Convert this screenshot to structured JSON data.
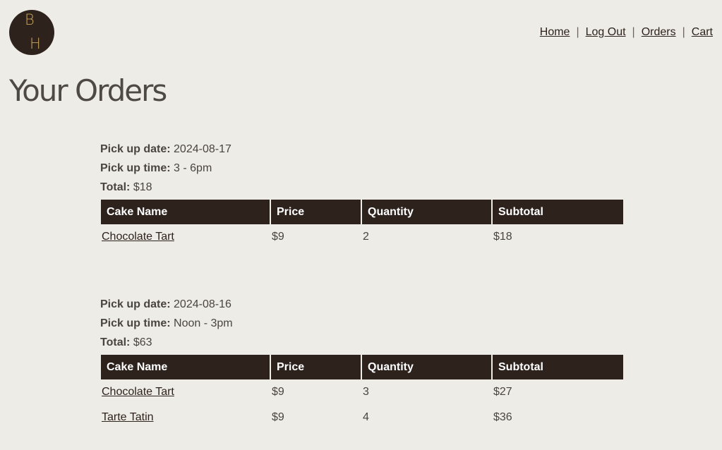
{
  "logo": {
    "top_letter": "B",
    "bottom_letter": "H"
  },
  "nav": {
    "items": [
      "Home",
      "Log Out",
      "Orders",
      "Cart"
    ],
    "separator": "|"
  },
  "page_title": "Your Orders",
  "labels": {
    "pickup_date": "Pick up date:",
    "pickup_time": "Pick up time:",
    "total": "Total:"
  },
  "table_headers": [
    "Cake Name",
    "Price",
    "Quantity",
    "Subtotal"
  ],
  "orders": [
    {
      "pickup_date": "2024-08-17",
      "pickup_time": "3 - 6pm",
      "total": "$18",
      "items": [
        {
          "name": "Chocolate Tart",
          "price": "$9",
          "quantity": "2",
          "subtotal": "$18"
        }
      ]
    },
    {
      "pickup_date": "2024-08-16",
      "pickup_time": "Noon - 3pm",
      "total": "$63",
      "items": [
        {
          "name": "Chocolate Tart",
          "price": "$9",
          "quantity": "3",
          "subtotal": "$27"
        },
        {
          "name": "Tarte Tatin",
          "price": "$9",
          "quantity": "4",
          "subtotal": "$36"
        }
      ]
    }
  ],
  "colors": {
    "background": "#eeece7",
    "header_dark": "#2e221d",
    "logo_gold": "#c9a45e",
    "text": "#4a4440"
  }
}
